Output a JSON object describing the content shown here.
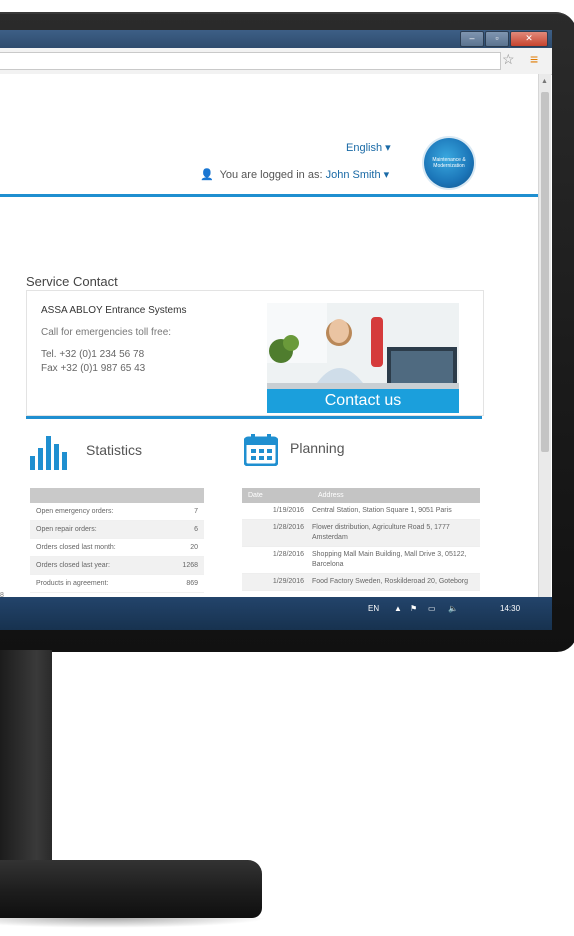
{
  "header": {
    "language": "English",
    "logged_in_prefix": "You are logged in as:",
    "user_name": "John Smith",
    "logo_text": "Maintenance & Modernization"
  },
  "service_contact": {
    "title": "Service Contact",
    "company": "ASSA ABLOY Entrance Systems",
    "call_text": "Call for emergencies toll free:",
    "tel": "Tel. +32 (0)1 234 56 78",
    "fax": "Fax +32 (0)1 987 65 43",
    "contact_button": "Contact us"
  },
  "statistics": {
    "title": "Statistics",
    "rows": [
      {
        "label": "Open emergency orders:",
        "value": "7"
      },
      {
        "label": "Open repair orders:",
        "value": "6"
      },
      {
        "label": "Orders closed last month:",
        "value": "20"
      },
      {
        "label": "Orders closed last year:",
        "value": "1268"
      },
      {
        "label": "Products in agreement:",
        "value": "869"
      }
    ]
  },
  "planning": {
    "title": "Planning",
    "headers": {
      "date": "Date",
      "address": "Address"
    },
    "rows": [
      {
        "date": "1/19/2016",
        "address": "Central Station, Station Square 1, 9051 Paris"
      },
      {
        "date": "1/28/2016",
        "address": "Flower distribution, Agriculture Road 5, 1777 Amsterdam"
      },
      {
        "date": "1/28/2016",
        "address": "Shopping Mall Main Building, Mall Drive 3, 05122, Barcelona"
      },
      {
        "date": "1/29/2016",
        "address": "Food Factory Sweden, Roskilderoad 20, Goteborg"
      }
    ]
  },
  "left_cut": {
    "v1": "8",
    "v2": "8"
  },
  "taskbar": {
    "lang": "EN",
    "time": "14:30"
  },
  "colors": {
    "accent": "#1f8fd0",
    "button": "#1b9fdc",
    "taskbar": "#1d3b5e"
  }
}
